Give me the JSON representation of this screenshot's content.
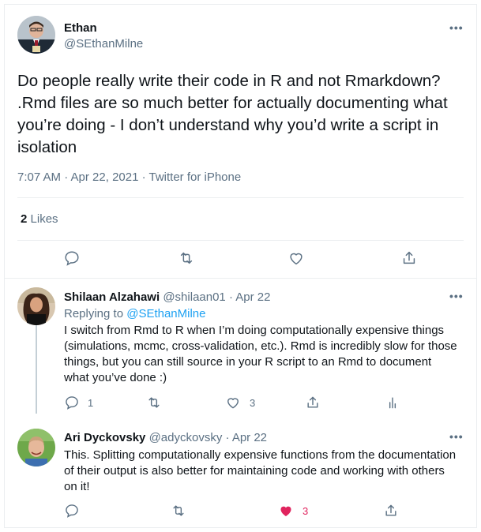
{
  "main_tweet": {
    "name": "Ethan",
    "handle": "@SEthanMilne",
    "text": "Do people really write their code in R and not Rmarkdown? .Rmd files are so much better for actually documenting what you’re doing - I don’t understand why you’d write a script in isolation",
    "meta": "7:07 AM · Apr 22, 2021 · Twitter for iPhone",
    "likes_count": "2",
    "likes_label": "Likes",
    "more": "•••"
  },
  "replies": [
    {
      "name": "Shilaan Alzahawi",
      "handle": "@shilaan01 · Apr 22",
      "replying_prefix": "Replying to ",
      "replying_to": "@SEthanMilne",
      "text": "I switch from Rmd to R when I’m doing computationally expensive things (simulations, mcmc, cross-validation, etc.). Rmd is incredibly slow for those things, but you can still source in your R script to an Rmd to document what you’ve done :)",
      "reply_count": "1",
      "like_count": "3",
      "more": "•••"
    },
    {
      "name": "Ari Dyckovsky",
      "handle": "@adyckovsky · Apr 22",
      "text": "This. Splitting computationally expensive functions from the documentation of their output is also better for maintaining code and working with others on it!",
      "like_count": "3",
      "more": "•••"
    }
  ],
  "colors": {
    "accent": "#1da1f2",
    "muted": "#5b7083",
    "like_active": "#e0245e",
    "border": "#ebeef0"
  },
  "icons": [
    "reply-icon",
    "retweet-icon",
    "like-icon",
    "share-icon",
    "analytics-icon",
    "more-icon"
  ]
}
